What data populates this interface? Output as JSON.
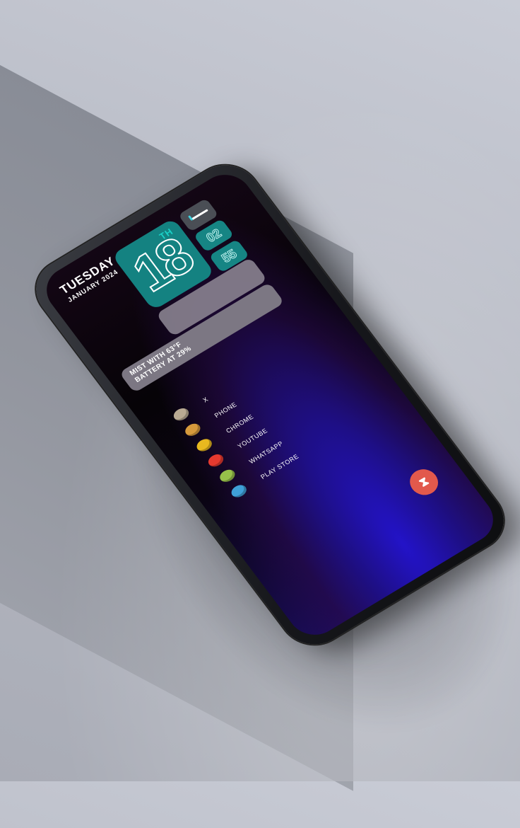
{
  "date": {
    "day": "TUESDAY",
    "month_year": "JANUARY 2024"
  },
  "widget": {
    "day_number": "18",
    "day_suffix": "TH",
    "hour": "02",
    "minute": "55",
    "status_line_1": "MIST WITH 63°F",
    "status_line_2": "BATTERY AT 29%"
  },
  "apps": [
    {
      "label": "X",
      "icon": "x-icon",
      "color": "#b9aa93"
    },
    {
      "label": "PHONE",
      "icon": "phone-icon",
      "color": "#d69a3c"
    },
    {
      "label": "CHROME",
      "icon": "chrome-icon",
      "color": "#e8b91f"
    },
    {
      "label": "YOUTUBE",
      "icon": "youtube-icon",
      "color": "#e53a2f"
    },
    {
      "label": "WHATSAPP",
      "icon": "whatsapp-icon",
      "color": "#97c04a"
    },
    {
      "label": "PLAY STORE",
      "icon": "play-store-icon",
      "color": "#3fa0d8"
    }
  ],
  "fab": {
    "icon": "hourglass-icon",
    "glyph": "⧗",
    "color": "#e2594c"
  },
  "colors": {
    "tile": "#148281",
    "screen_glow": "#2313c8"
  }
}
